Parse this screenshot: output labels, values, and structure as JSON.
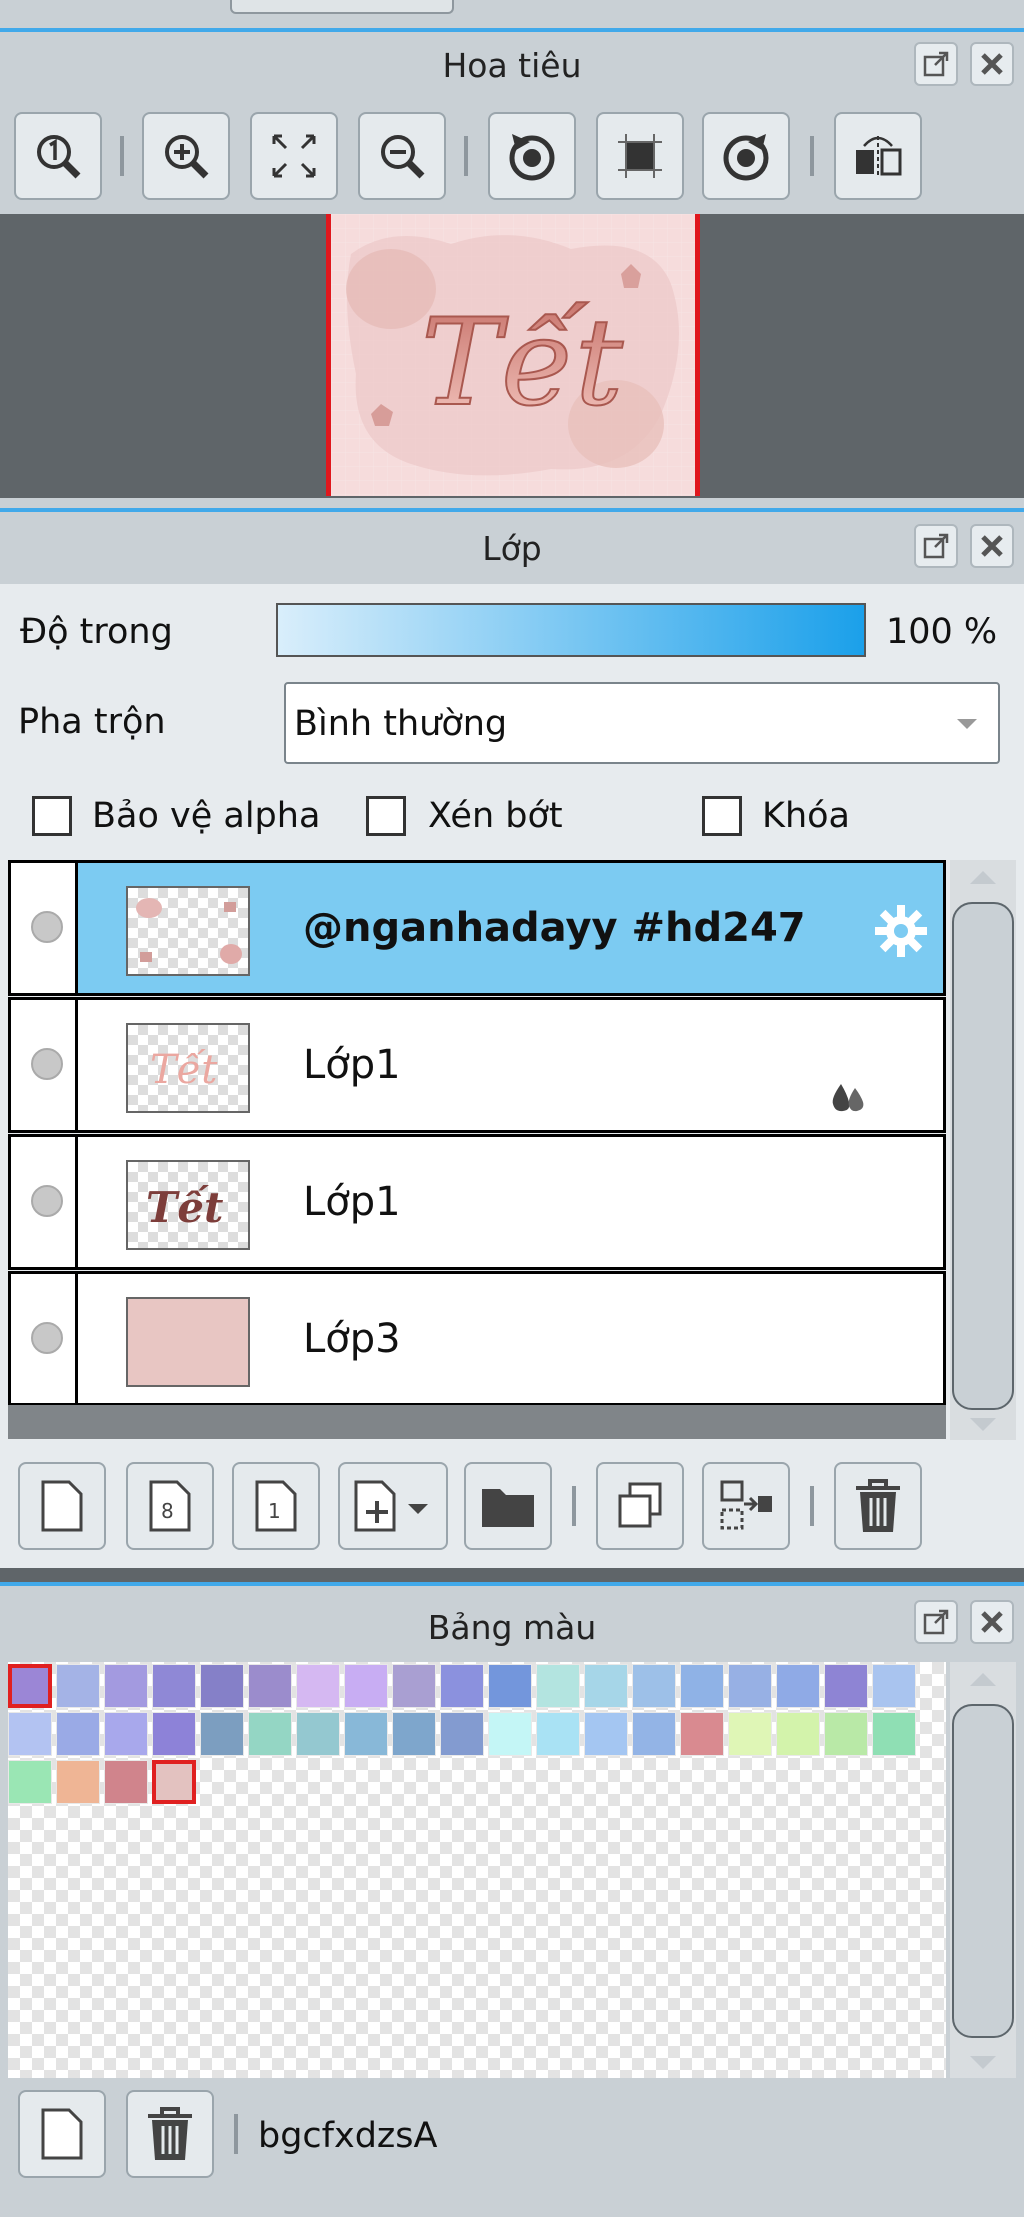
{
  "navigator": {
    "title": "Hoa tiêu",
    "buttons": [
      "zoom-actual-icon",
      "zoom-in-icon",
      "fit-screen-icon",
      "zoom-out-icon",
      "rotate-left-icon",
      "reset-view-icon",
      "rotate-right-icon",
      "flip-horizontal-icon"
    ],
    "preview_text": "Tết"
  },
  "layers": {
    "title": "Lớp",
    "opacity_label": "Độ trong",
    "opacity_value": "100 %",
    "opacity_fraction": 1.0,
    "blend_label": "Pha trộn",
    "blend_value": "Bình thường",
    "protect_alpha_label": "Bảo vệ alpha",
    "clip_label": "Xén bớt",
    "lock_label": "Khóa",
    "items": [
      {
        "name": "@nganhadayy #hd247",
        "selected": true
      },
      {
        "name": "Lớp1",
        "selected": false
      },
      {
        "name": "Lớp1",
        "selected": false
      },
      {
        "name": "Lớp3",
        "selected": false
      }
    ],
    "toolbar_icons": [
      "new-layer-icon",
      "new-8bit-layer-icon",
      "new-1bit-layer-icon",
      "add-layer-menu-icon",
      "new-folder-icon",
      "duplicate-layer-icon",
      "merge-down-icon",
      "delete-layer-icon"
    ]
  },
  "palette": {
    "title": "Bảng màu",
    "name": "bgcfxdzsA",
    "colors": [
      "#9b86d6",
      "#a4b3e6",
      "#a39ae0",
      "#8f88d6",
      "#8580c8",
      "#9b8ccc",
      "#d5b8f2",
      "#c8adf3",
      "#a99fd2",
      "#8b91de",
      "#7396dc",
      "#b3e4e0",
      "#a6d6e8",
      "#9dc0e8",
      "#8fb2e6",
      "#97b0e4",
      "#8faae6",
      "#8e84d4",
      "#a9c4ef",
      "#b3c3f2",
      "#9aaae6",
      "#a8a8ec",
      "#8d82d8",
      "#7c9ec0",
      "#94d6c4",
      "#94c8d0",
      "#88b8d8",
      "#7ea6cc",
      "#839bd0",
      "#c4f6f6",
      "#a9e2f4",
      "#a4c6f2",
      "#93b4e6",
      "#d98a90",
      "#dff6b6",
      "#d3f3ab",
      "#b9e9a7",
      "#8fdfb4",
      "#9ae6b4",
      "#efb595",
      "#d0848c",
      "#e3c2c0"
    ],
    "selected_index": 41
  }
}
